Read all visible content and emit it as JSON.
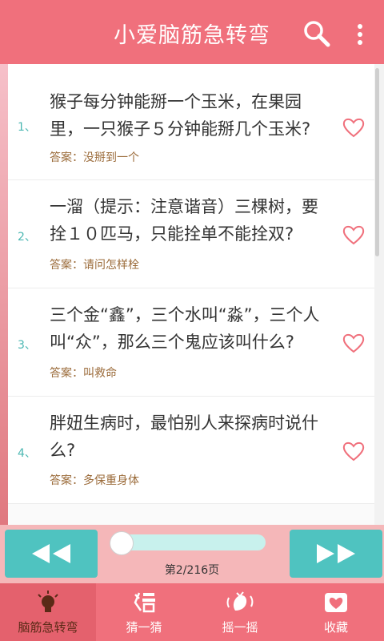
{
  "app_bar": {
    "title": "小爱脑筋急转弯",
    "search_icon": "search-icon",
    "more_icon": "more-vert-icon",
    "color": "#f0707c"
  },
  "questions": [
    {
      "number": "1、",
      "text": "猴子每分钟能掰一个玉米，在果园里，一只猴子５分钟能掰几个玉米?",
      "answer": "答案：没掰到一个",
      "favorite_icon": "heart-outline-icon"
    },
    {
      "number": "2、",
      "text": "一溜（提示：注意谐音）三棵树，要拴１０匹马，只能拴单不能拴双?",
      "answer": "答案：请问怎样栓",
      "favorite_icon": "heart-outline-icon"
    },
    {
      "number": "3、",
      "text": "三个金“鑫”，三个水叫“淼”，三个人叫“众”，那么三个鬼应该叫什么?",
      "answer": "答案：叫救命",
      "favorite_icon": "heart-outline-icon"
    },
    {
      "number": "4、",
      "text": "胖妞生病时，最怕别人来探病时说什么?",
      "answer": "答案：多保重身体",
      "favorite_icon": "heart-outline-icon"
    }
  ],
  "player": {
    "page_indicator": "第2/216页",
    "current_page": 2,
    "total_pages": 216,
    "prev_icon": "rewind-icon",
    "next_icon": "fast-forward-icon",
    "accent": "#4fc3c0"
  },
  "tabs": [
    {
      "label": "脑筋急转弯",
      "icon": "lightbulb-icon",
      "active": true
    },
    {
      "label": "猜一猜",
      "icon": "guess-icon",
      "active": false
    },
    {
      "label": "摇一摇",
      "icon": "shake-icon",
      "active": false
    },
    {
      "label": "收藏",
      "icon": "favorites-box-icon",
      "active": false
    }
  ]
}
